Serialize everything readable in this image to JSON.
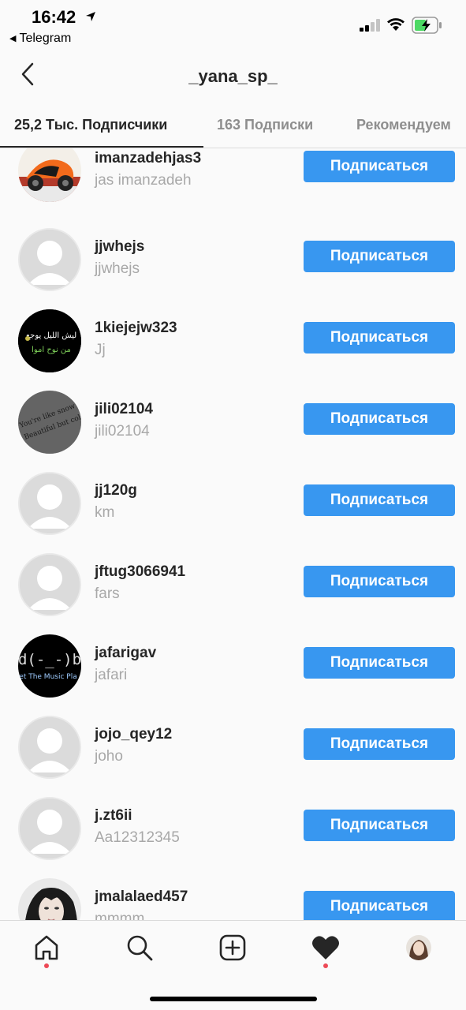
{
  "status_bar": {
    "time": "16:42",
    "back_app": "Telegram"
  },
  "header": {
    "title": "_yana_sp_"
  },
  "tabs": [
    {
      "label": "25,2 Тыс. Подписчики",
      "active": true
    },
    {
      "label": "163 Подписки",
      "active": false
    },
    {
      "label": "Рекомендуем",
      "active": false
    }
  ],
  "follow_label": "Подписаться",
  "users": [
    {
      "username": "imanzadehjas3",
      "name": "jas imanzadeh",
      "avatar": "motorcycle-photo"
    },
    {
      "username": "jjwhejs",
      "name": "jjwhejs",
      "avatar": "default"
    },
    {
      "username": "1kiejejw323",
      "name": "Jj",
      "avatar": "arabic-text-photo"
    },
    {
      "username": "jili02104",
      "name": "jili02104",
      "avatar": "gray-text-photo"
    },
    {
      "username": "jj120g",
      "name": "km",
      "avatar": "default"
    },
    {
      "username": "jftug3066941",
      "name": "fars",
      "avatar": "default"
    },
    {
      "username": "jafarigav",
      "name": "jafari",
      "avatar": "music-logo-photo"
    },
    {
      "username": "jojo_qey12",
      "name": "joho",
      "avatar": "default"
    },
    {
      "username": "j.zt6ii",
      "name": "Aa12312345",
      "avatar": "default"
    },
    {
      "username": "jmalalaed457",
      "name": "mmmm",
      "avatar": "portrait-photo"
    }
  ],
  "avatar_texts": {
    "arabic_line1": "ليش الليل يوجع",
    "arabic_line2": "من نوح اموا",
    "gray_line1": "You're like snow",
    "gray_line2": "Beautiful but cold",
    "music_line1": "d(-_-)b",
    "music_line2": "et The Music Pla"
  },
  "colors": {
    "accent": "#3897f0",
    "notification": "#ed4956"
  }
}
